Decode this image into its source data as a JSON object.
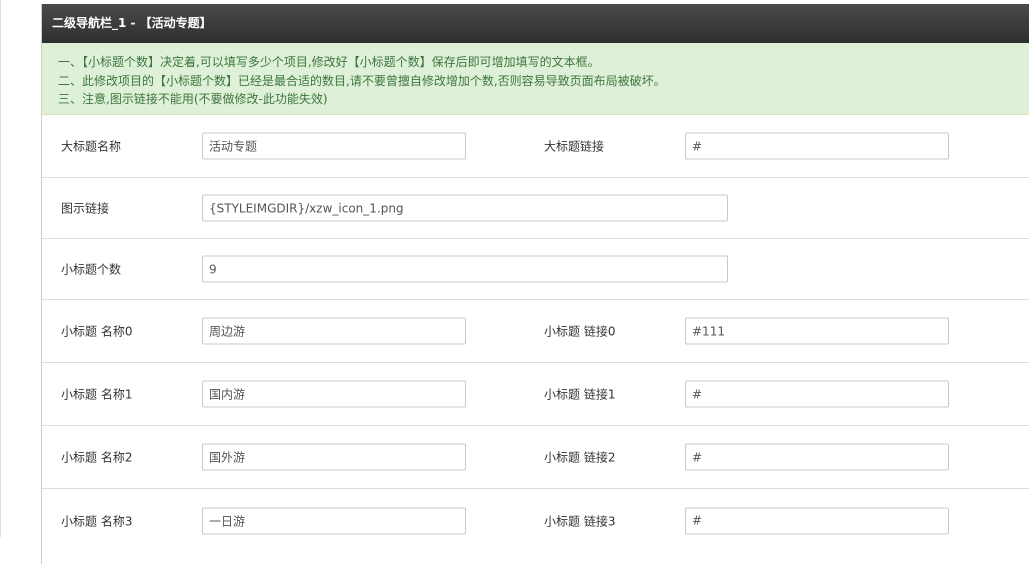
{
  "header": {
    "title": "二级导航栏_1 - 【活动专题】"
  },
  "notice": {
    "lines": [
      "一、【小标题个数】决定着,可以填写多少个项目,修改好【小标题个数】保存后即可增加填写的文本框。",
      "二、此修改项目的【小标题个数】已经是最合适的数目,请不要曾擅自修改增加个数,否则容易导致页面布局被破坏。",
      "三、注意,图示链接不能用(不要做修改-此功能失效)"
    ]
  },
  "form": {
    "main_title": {
      "label": "大标题名称",
      "value": "活动专题"
    },
    "main_link": {
      "label": "大标题链接",
      "value": "#"
    },
    "icon_link": {
      "label": "图示链接",
      "value": "{STYLEIMGDIR}/xzw_icon_1.png"
    },
    "sub_count": {
      "label": "小标题个数",
      "value": "9"
    },
    "subs": [
      {
        "name_label": "小标题 名称0",
        "name_value": "周边游",
        "link_label": "小标题 链接0",
        "link_value": "#111"
      },
      {
        "name_label": "小标题 名称1",
        "name_value": "国内游",
        "link_label": "小标题 链接1",
        "link_value": "#"
      },
      {
        "name_label": "小标题 名称2",
        "name_value": "国外游",
        "link_label": "小标题 链接2",
        "link_value": "#"
      },
      {
        "name_label": "小标题 名称3",
        "name_value": "一日游",
        "link_label": "小标题 链接3",
        "link_value": "#"
      }
    ]
  },
  "colors": {
    "header_bg": "#333333",
    "notice_bg": "#dff0d8",
    "notice_text": "#3c763d"
  }
}
